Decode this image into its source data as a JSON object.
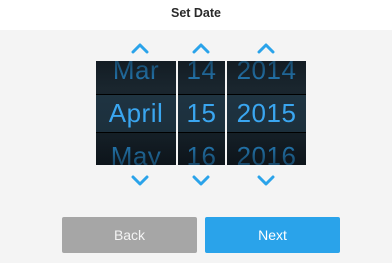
{
  "header": {
    "title": "Set Date"
  },
  "picker": {
    "month": {
      "prev": "Mar",
      "current": "April",
      "next": "May"
    },
    "day": {
      "prev": "14",
      "current": "15",
      "next": "16"
    },
    "year": {
      "prev": "2014",
      "current": "2015",
      "next": "2016"
    }
  },
  "buttons": {
    "back_label": "Back",
    "next_label": "Next"
  },
  "icons": {
    "up": "chevron-up-icon",
    "down": "chevron-down-icon"
  },
  "colors": {
    "accent": "#2aa3ea",
    "wheel_text": "#3aa6f0",
    "wheel_bg": "#1a252d",
    "back_button": "#a6a6a6"
  }
}
